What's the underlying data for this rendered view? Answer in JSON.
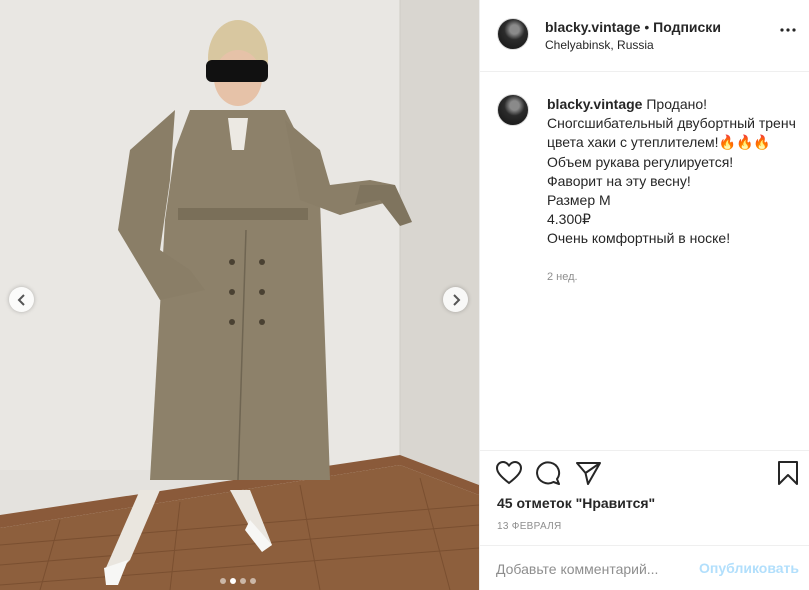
{
  "post": {
    "username": "blacky.vintage",
    "separator": " • ",
    "follow_label": "Подписки",
    "location": "Chelyabinsk, Russia"
  },
  "caption": {
    "username": "blacky.vintage",
    "lines": [
      "Продано!",
      "Сногсшибательный двубортный тренч цвета хаки с утеплителем!🔥🔥🔥",
      "Объем рукава регулируется!",
      "Фаворит на эту весну!",
      "Размер М",
      "4.300₽",
      "Очень комфортный в носке!"
    ],
    "time_ago": "2 нед."
  },
  "likes_text": "45 отметок \"Нравится\"",
  "date_text": "13 ФЕВРАЛЯ",
  "comment": {
    "placeholder": "Добавьте комментарий...",
    "publish_label": "Опубликовать"
  },
  "carousel": {
    "total": 4,
    "active_index": 1
  },
  "icons": [
    "chevron-left-icon",
    "chevron-right-icon",
    "more-icon",
    "heart-icon",
    "comment-icon",
    "share-icon",
    "bookmark-icon"
  ],
  "colors": {
    "text": "#262626",
    "secondary": "#8e8e8e",
    "publish_disabled": "#b2dffc",
    "border": "#efefef"
  }
}
